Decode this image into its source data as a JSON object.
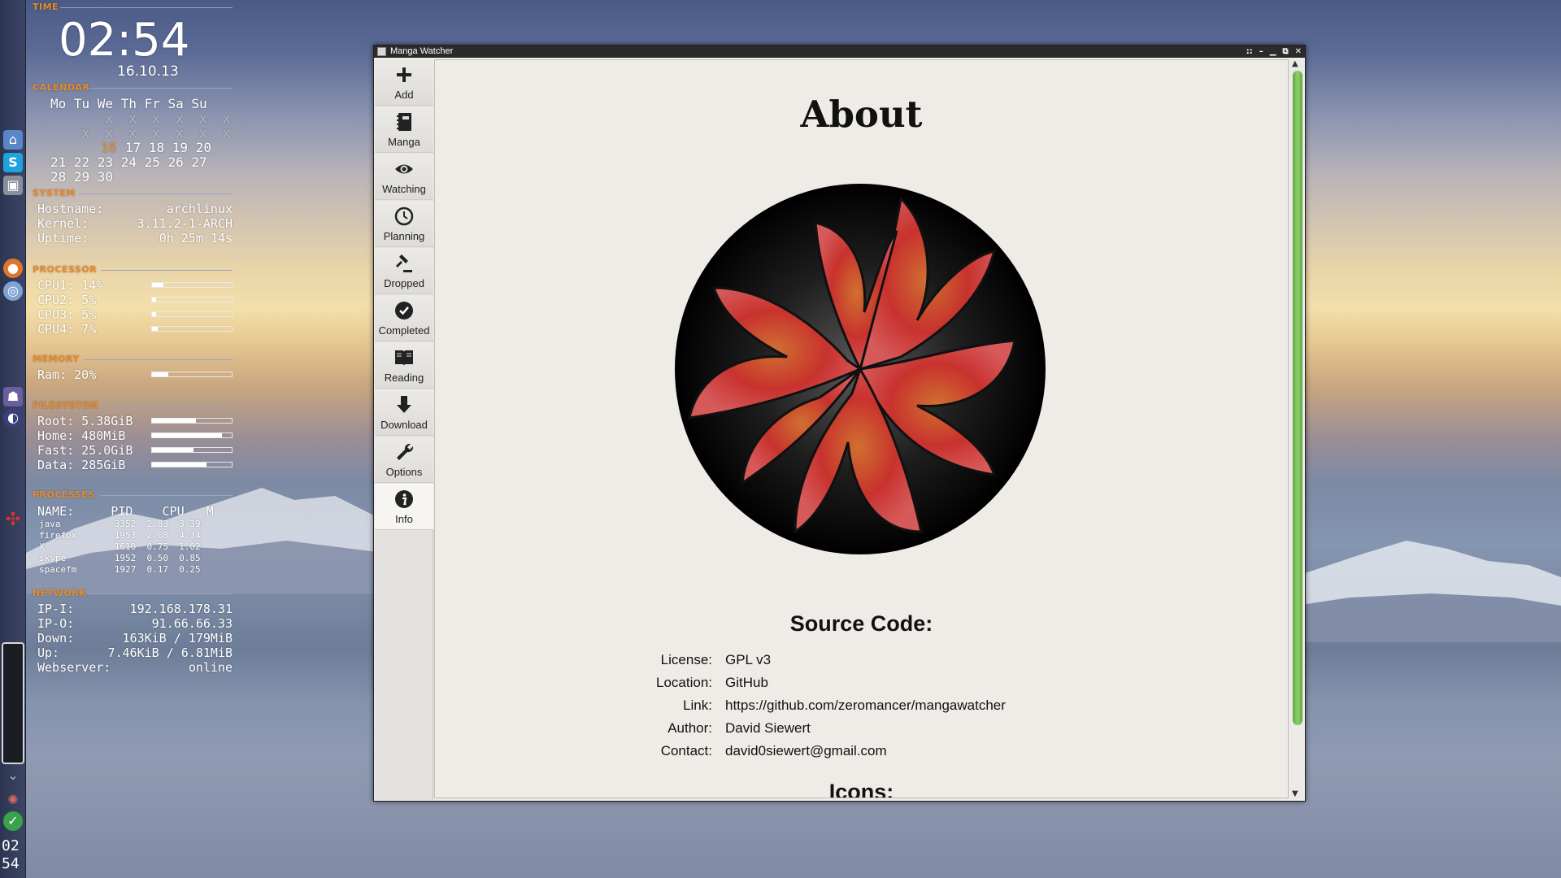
{
  "desktop": {
    "dock": {
      "clock_hour": "02",
      "clock_min": "54"
    },
    "conky": {
      "time": {
        "header": "TIME",
        "clock": "02:54",
        "date": "16.10.13"
      },
      "calendar": {
        "header": "CALENDAR",
        "weekdays": "Mo Tu We Th Fr Sa Su",
        "row_x1": "       x  x  x  x  x  x",
        "row_x2": "    x  x  x  x  x  x  x",
        "today": "16",
        "week3_rest": "17 18 19 20",
        "week4": "21 22 23 24 25 26 27",
        "week5": "28 29 30"
      },
      "system": {
        "header": "SYSTEM",
        "hostname_label": "Hostname:",
        "hostname": "archlinux",
        "kernel_label": "Kernel:",
        "kernel": "3.11.2-1-ARCH",
        "uptime_label": "Uptime:",
        "uptime": "0h 25m 14s"
      },
      "processor": {
        "header": "PROCESSOR",
        "cpus": [
          {
            "label": "CPU1: 14%",
            "value": 0.14
          },
          {
            "label": "CPU2: 5%",
            "value": 0.05
          },
          {
            "label": "CPU3: 5%",
            "value": 0.05
          },
          {
            "label": "CPU4: 7%",
            "value": 0.07
          }
        ]
      },
      "memory": {
        "header": "MEMORY",
        "label": "Ram:  20%",
        "value": 0.2
      },
      "filesystem": {
        "header": "FILESYSTEM",
        "items": [
          {
            "label": "Root: 5.38GiB",
            "value": 0.55
          },
          {
            "label": "Home: 480MiB",
            "value": 0.88
          },
          {
            "label": "Fast: 25.0GiB",
            "value": 0.52
          },
          {
            "label": "Data: 285GiB",
            "value": 0.68
          }
        ]
      },
      "processes": {
        "header": "PROCESSES",
        "columns": "NAME:     PID    CPU   M",
        "rows": [
          "java          3352  2.83  3.39",
          "firefox       1953  2.08  4.34",
          "X             1610  0.75  1.02",
          "skype         1952  0.50  0.85",
          "spacefm       1927  0.17  0.25"
        ]
      },
      "network": {
        "header": "NETWORK",
        "ipi_label": "IP-I:",
        "ipi": "192.168.178.31",
        "ipo_label": "IP-O:",
        "ipo": "91.66.66.33",
        "down_label": "Down:",
        "down": "163KiB / 179MiB",
        "up_label": "Up:",
        "up": "7.46KiB / 6.81MiB",
        "web_label": "Webserver:",
        "web": "online"
      }
    }
  },
  "window": {
    "title": "Manga Watcher",
    "controls": [
      "::",
      "–",
      "▁",
      "⧉",
      "✕"
    ],
    "toolbar": [
      {
        "label": "Add",
        "icon": "plus-icon"
      },
      {
        "label": "Manga",
        "icon": "notebook-icon"
      },
      {
        "label": "Watching",
        "icon": "eye-icon"
      },
      {
        "label": "Planning",
        "icon": "clock-icon"
      },
      {
        "label": "Dropped",
        "icon": "gavel-icon"
      },
      {
        "label": "Completed",
        "icon": "checkmark-icon"
      },
      {
        "label": "Reading",
        "icon": "open-book-icon"
      },
      {
        "label": "Download",
        "icon": "download-arrow-icon"
      },
      {
        "label": "Options",
        "icon": "wrench-icon"
      },
      {
        "label": "Info",
        "icon": "info-icon",
        "active": true
      }
    ],
    "about": {
      "title": "About",
      "source_title": "Source Code:",
      "rows": [
        {
          "label": "License:",
          "value": "GPL v3"
        },
        {
          "label": "Location:",
          "value": "GitHub"
        },
        {
          "label": "Link:",
          "value": "https://github.com/zeromancer/mangawatcher"
        },
        {
          "label": "Author:",
          "value": "David Siewert"
        },
        {
          "label": "Contact:",
          "value": "david0siewert@gmail.com"
        }
      ],
      "icons_title": "Icons:"
    },
    "colors": {
      "accent": "#e88b2a",
      "scroll_thumb": "#6cb84e",
      "logo_red": "#c8322e"
    }
  }
}
